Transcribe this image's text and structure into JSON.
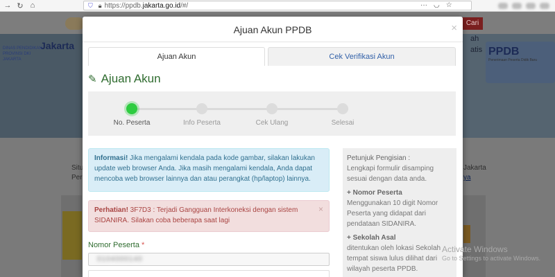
{
  "browser": {
    "url_prefix": "https://ppdb.",
    "url_host": "jakarta.go.id",
    "url_suffix": "/#/"
  },
  "background": {
    "cari_label": "Cari",
    "jakarta_logo": "Jakarta",
    "dinas_text": "DINAS PENDIDIKAN PROVINSI DKI JAKARTA",
    "right_text_line1": "ah",
    "right_text_line2": "atis",
    "ppdb_logo": "PPDB",
    "ppdb_sub": "Penerimaan Peserta Didik Baru",
    "situ_line1": "Situ",
    "situ_line2": "Per",
    "jakarta_link_line1": "Jakarta",
    "jakarta_link_line2": "ya"
  },
  "windows_watermark": {
    "title": "Activate Windows",
    "subtitle": "Go to Settings to activate Windows."
  },
  "modal": {
    "title": "Ajuan Akun PPDB",
    "close_glyph": "×",
    "tabs": [
      {
        "label": "Ajuan Akun",
        "active": true
      },
      {
        "label": "Cek Verifikasi Akun",
        "active": false
      }
    ],
    "section_title": "Ajuan Akun",
    "steps": [
      {
        "label": "No. Peserta",
        "active": true
      },
      {
        "label": "Info Peserta",
        "active": false
      },
      {
        "label": "Cek Ulang",
        "active": false
      },
      {
        "label": "Selesai",
        "active": false
      }
    ],
    "info_alert": {
      "bold": "Informasi!",
      "text": " Jika mengalami kendala pada kode gambar, silakan lakukan update web browser Anda. Jika masih mengalami kendala, Anda dapat mencoba web browser lainnya dan atau perangkat (hp/laptop) lainnya."
    },
    "danger_alert": {
      "bold": "Perhatian!",
      "text": " 3F7D3 : Terjadi Gangguan Interkoneksi dengan sistem SIDANIRA. Silakan coba beberapa saat lagi",
      "close_glyph": "×"
    },
    "field": {
      "label": "Nomor Peserta",
      "required_mark": "*",
      "value": "0104000140"
    },
    "help": {
      "title": "Petunjuk Pengisian :",
      "intro": "Lengkapi formulir disamping sesuai dengan data anda.",
      "items": [
        {
          "heading": "+ Nomor Peserta",
          "text": "Menggunakan 10 digit Nomor Peserta yang didapat dari pendataan SIDANIRA."
        },
        {
          "heading": "+ Sekolah Asal",
          "text": "ditentukan oleh lokasi Sekolah tempat siswa lulus dilihat dari wilayah peserta PPDB."
        }
      ]
    }
  },
  "colors": {
    "accent_green": "#2e6b2e",
    "step_active": "#2ecc40",
    "tab_link": "#3160a8",
    "info_bg": "#d9edf7",
    "danger_bg": "#f2dede"
  }
}
